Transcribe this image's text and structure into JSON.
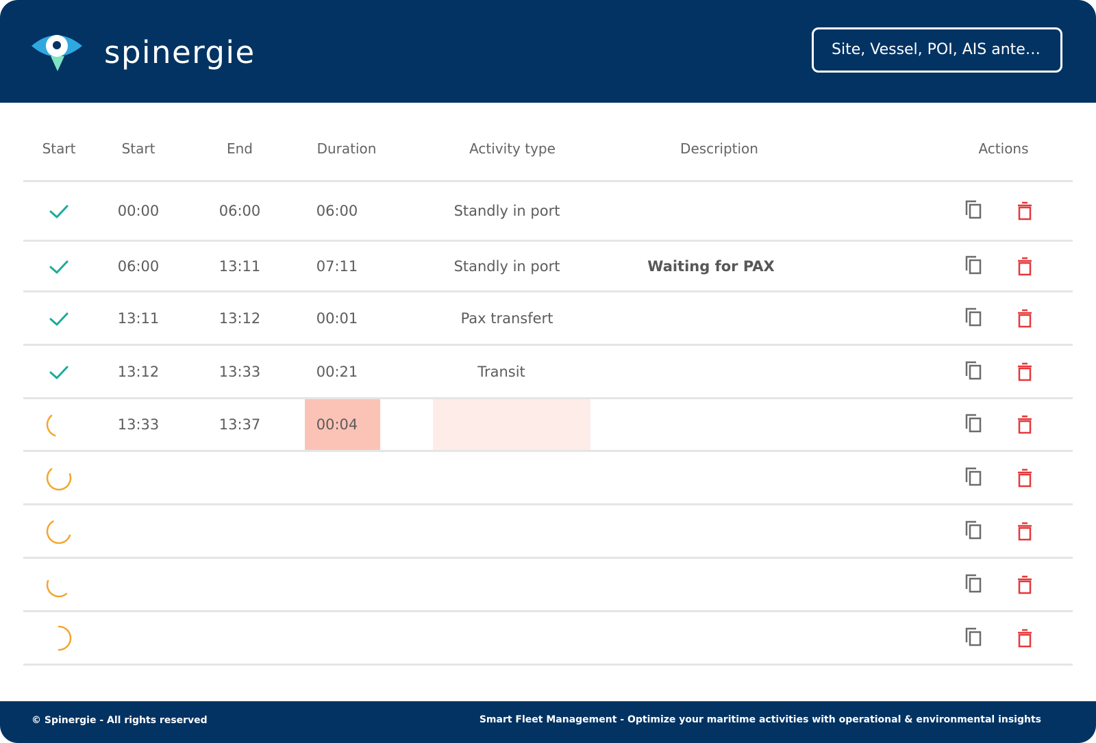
{
  "header": {
    "logo_text": "spinergie",
    "search_placeholder": "Site, Vessel, POI, AIS anten..."
  },
  "table": {
    "columns": {
      "status": "Start",
      "start": "Start",
      "end": "End",
      "duration": "Duration",
      "activity_type": "Activity type",
      "description": "Description",
      "actions": "Actions"
    },
    "rows": [
      {
        "status": "done",
        "start": "00:00",
        "end": "06:00",
        "duration": "06:00",
        "activity_type": "Standly in port",
        "description": ""
      },
      {
        "status": "done",
        "start": "06:00",
        "end": "13:11",
        "duration": "07:11",
        "activity_type": "Standly in port",
        "description": "Waiting for PAX"
      },
      {
        "status": "done",
        "start": "13:11",
        "end": "13:12",
        "duration": "00:01",
        "activity_type": "Pax transfert",
        "description": ""
      },
      {
        "status": "done",
        "start": "13:12",
        "end": "13:33",
        "duration": "00:21",
        "activity_type": "Transit",
        "description": ""
      },
      {
        "status": "loading",
        "start": "13:33",
        "end": "13:37",
        "duration": "00:04",
        "activity_type": "",
        "description": "",
        "highlighted": true
      },
      {
        "status": "loading",
        "start": "",
        "end": "",
        "duration": "",
        "activity_type": "",
        "description": ""
      },
      {
        "status": "loading",
        "start": "",
        "end": "",
        "duration": "",
        "activity_type": "",
        "description": ""
      },
      {
        "status": "loading",
        "start": "",
        "end": "",
        "duration": "",
        "activity_type": "",
        "description": ""
      },
      {
        "status": "loading",
        "start": "",
        "end": "",
        "duration": "",
        "activity_type": "",
        "description": ""
      }
    ]
  },
  "icons": {
    "done": "check-icon",
    "loading": "spinner-icon",
    "copy": "copy-icon",
    "delete": "trash-icon"
  },
  "colors": {
    "header_bg": "#033363",
    "check": "#1aab9b",
    "spinner": "#f3a52b",
    "delete": "#e5383b",
    "copy": "#6b6b6b",
    "duration_highlight": "#fbc3b6",
    "activity_highlight": "#fdece8"
  },
  "footer": {
    "copyright": "© Spinergie - All rights reserved",
    "tagline": "Smart Fleet Management - Optimize your maritime activities with operational & environmental insights"
  }
}
